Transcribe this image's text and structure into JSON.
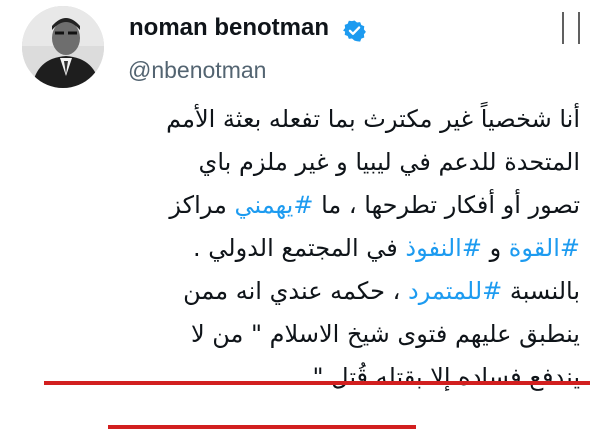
{
  "author": {
    "name": "noman benotman",
    "handle": "@nbenotman",
    "verified": true,
    "avatar": "profile-photo"
  },
  "colors": {
    "text": "#0f1419",
    "secondary": "#536471",
    "hashtag": "#1d9bf0",
    "verified": "#1d9bf0",
    "underline": "#d21f1f"
  },
  "tweet": {
    "line1": "أنا شخصياً غير مكترث بما تفعله بعثة الأمم",
    "line2": "المتحدة للدعم في ليبيا و غير ملزم باي",
    "line3_before": "تصور أو أفكار تطرحها ، ما ",
    "line3_hashtag": "#يهمني",
    "line3_after": " مراكز",
    "line4_hashtag1": "#القوة",
    "line4_mid": " و ",
    "line4_hashtag2": "#النفوذ",
    "line4_after": " في المجتمع الدولي .",
    "line5_before": "بالنسبة ",
    "line5_hashtag": "#للمتمرد",
    "line5_after": " ، حكمه عندي انه ممن",
    "line6": "ينطبق عليهم فتوى شيخ الاسلام \" من لا",
    "line7": "يندفع فساده إلا بقتله قُتل \""
  }
}
